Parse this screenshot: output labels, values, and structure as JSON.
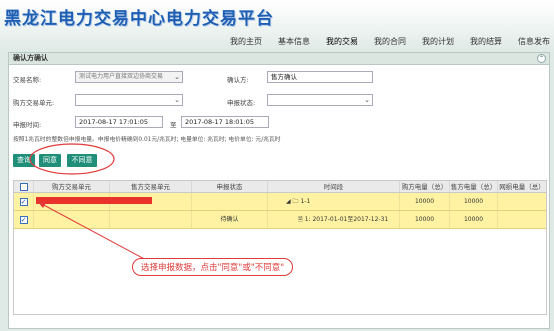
{
  "app": {
    "title": "黑龙江电力交易中心电力交易平台"
  },
  "nav": {
    "items": [
      "我的主页",
      "基本信息",
      "我的交易",
      "我的合同",
      "我的计划",
      "我的结算",
      "信息发布"
    ]
  },
  "panel": {
    "title": "确认方确认",
    "collapse_icon": "⌃"
  },
  "form": {
    "trade_name_label": "交易名称:",
    "trade_name_value": "测试电力用户直接双边协商交易",
    "confirmer_label": "确认方:",
    "confirmer_value": "售方确认",
    "buyer_unit_label": "购方交易单元:",
    "buyer_unit_value": "",
    "apply_status_label": "申报状态:",
    "apply_status_value": "",
    "apply_time_label": "申报时间:",
    "apply_time_start": "2017-08-17 17:01:05",
    "to_label": "至",
    "apply_time_end": "2017-08-17 18:01:05"
  },
  "note": "按照1兆瓦时的整数倍申报电量。申报电价精确到0.01元/兆瓦时; 电量单位: 兆瓦时; 电价单位: 元/兆瓦时",
  "buttons": {
    "query": "查询",
    "agree": "同意",
    "disagree": "不同意"
  },
  "table": {
    "columns": [
      "购方交易单元",
      "售方交易单元",
      "申报状态",
      "时间段",
      "购方电量（总）",
      "售方电量（总）",
      "网损电量（总）"
    ],
    "rows": [
      {
        "checked": true,
        "buyer": "",
        "seller": "",
        "status": "",
        "period": "1-1",
        "buyer_qty": "10000",
        "seller_qty": "10000",
        "loss_qty": ""
      },
      {
        "checked": true,
        "buyer": "",
        "seller": "",
        "status": "待确认",
        "period": "1: 2017-01-01至2017-12-31",
        "buyer_qty": "10000",
        "seller_qty": "10000",
        "loss_qty": ""
      }
    ]
  },
  "annotation": "选择申报数据，点击\"同意\"或\"不同意\"",
  "colors": {
    "title_blue": "#1e5fb4",
    "button_teal": "#1f8f7a",
    "row_highlight": "#fff3a3",
    "annotation_red": "#e03a3a"
  }
}
